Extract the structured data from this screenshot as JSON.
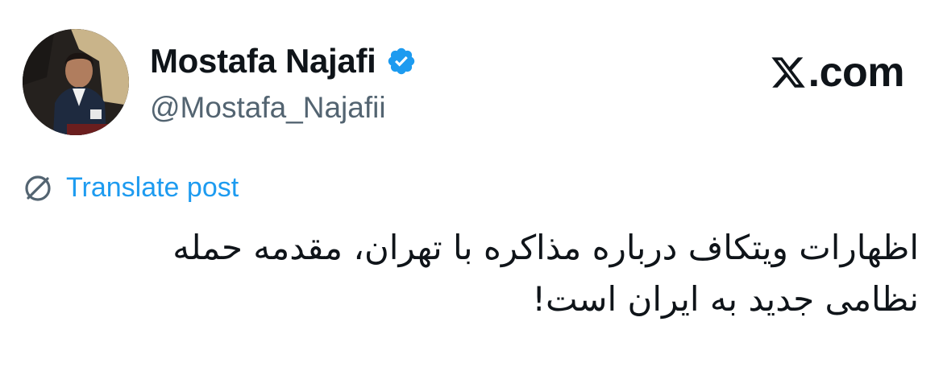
{
  "author": {
    "display_name": "Mostafa Najafi",
    "handle": "@Mostafa_Najafii",
    "verified": true,
    "verified_icon": "verified-badge-icon",
    "avatar": "profile-photo"
  },
  "site": {
    "logo_icon": "x-logo-icon",
    "label": ".com"
  },
  "translate": {
    "icon": "globe-icon",
    "label": "Translate post"
  },
  "post": {
    "lines": [
      "اظهارات ویتکاف درباره مذاکره با تهران، مقدمه حمله",
      "نظامی جدید به ایران است!"
    ]
  },
  "colors": {
    "accent": "#1d9bf0",
    "text_primary": "#0f1419",
    "text_secondary": "#536471",
    "background": "#ffffff"
  }
}
